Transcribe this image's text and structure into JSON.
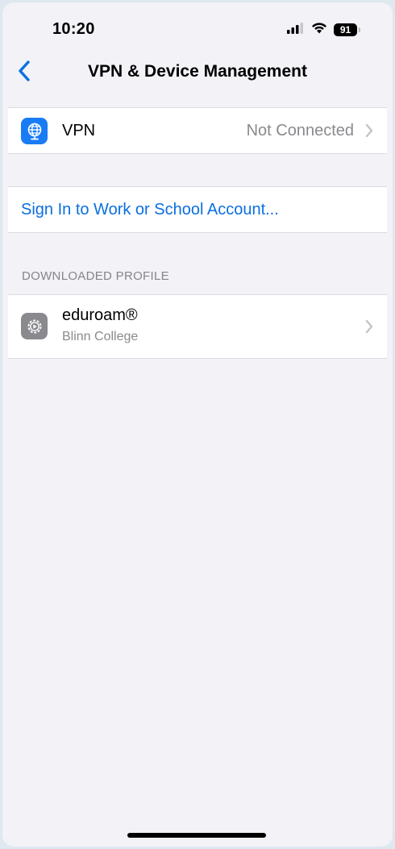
{
  "status_bar": {
    "time": "10:20",
    "battery": "91",
    "icons": [
      "signal-icon",
      "wifi-icon",
      "battery-icon"
    ]
  },
  "nav": {
    "back_icon": "chevron-left-icon",
    "title": "VPN & Device Management"
  },
  "vpn_row": {
    "icon": "globe-icon",
    "label": "VPN",
    "value": "Not Connected"
  },
  "account_row": {
    "label": "Sign In to Work or School Account..."
  },
  "profiles_section": {
    "header": "DOWNLOADED PROFILE",
    "items": [
      {
        "icon": "gear-icon",
        "name": "eduroam®",
        "org": "Blinn College"
      }
    ]
  },
  "colors": {
    "accent": "#0a6fe0",
    "vpn_icon_bg": "#1a7cf5",
    "profile_icon_bg": "#8a8a8e",
    "background": "#f2f2f7"
  }
}
